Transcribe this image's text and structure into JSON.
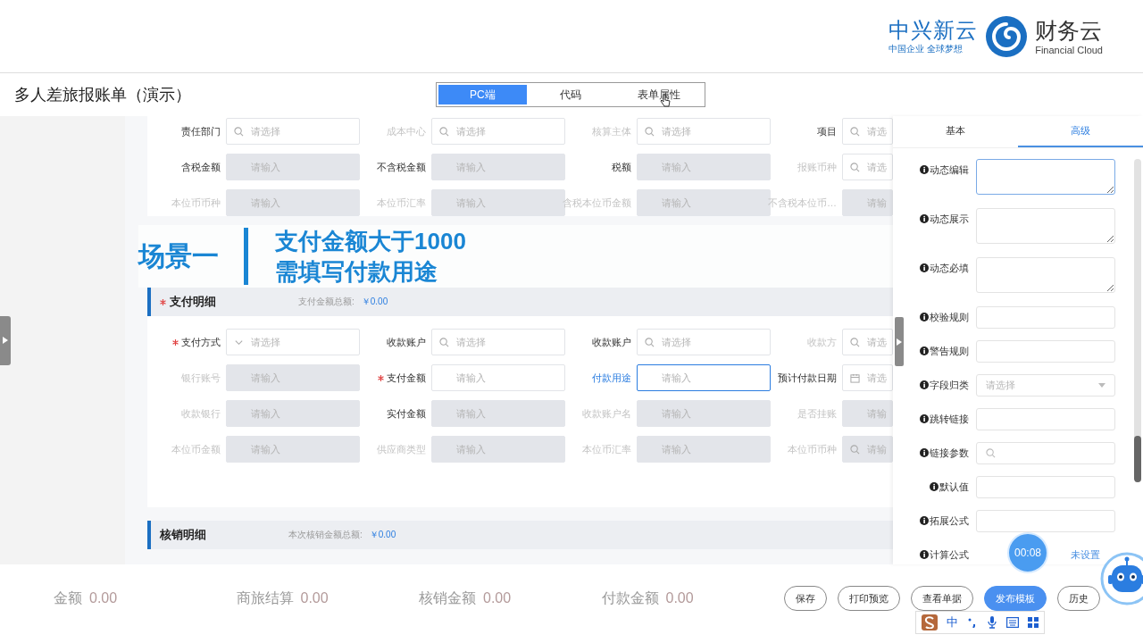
{
  "header": {
    "brand": "中兴新云",
    "slogan": "中国企业 全球梦想",
    "product": "财务云",
    "product_en": "Financial Cloud"
  },
  "title": "多人差旅报账单（演示）",
  "view_tabs": [
    {
      "label": "PC端",
      "selected": true
    },
    {
      "label": "代码",
      "selected": false
    },
    {
      "label": "表单属性",
      "selected": false
    }
  ],
  "form_top": {
    "rows": [
      [
        {
          "label": "责任部门",
          "kind": "select",
          "placeholder": "请选择",
          "muted": false,
          "readonly": false,
          "required": false,
          "focused": false
        },
        {
          "label": "成本中心",
          "kind": "select",
          "placeholder": "请选择",
          "muted": true,
          "readonly": false,
          "required": false,
          "focused": false
        },
        {
          "label": "核算主体",
          "kind": "select",
          "placeholder": "请选择",
          "muted": true,
          "readonly": false,
          "required": false,
          "focused": false
        },
        {
          "label": "项目",
          "kind": "select",
          "placeholder": "请选",
          "muted": false,
          "readonly": false,
          "required": false,
          "focused": false
        }
      ],
      [
        {
          "label": "含税金额",
          "kind": "text",
          "placeholder": "请输入",
          "muted": false,
          "readonly": true,
          "required": false,
          "focused": false
        },
        {
          "label": "不含税金额",
          "kind": "text",
          "placeholder": "请输入",
          "muted": false,
          "readonly": true,
          "required": false,
          "focused": false
        },
        {
          "label": "税额",
          "kind": "text",
          "placeholder": "请输入",
          "muted": false,
          "readonly": true,
          "required": false,
          "focused": false
        },
        {
          "label": "报账币种",
          "kind": "select",
          "placeholder": "请选",
          "muted": true,
          "readonly": false,
          "required": false,
          "focused": false
        }
      ],
      [
        {
          "label": "本位币币种",
          "kind": "text",
          "placeholder": "请输入",
          "muted": true,
          "readonly": true,
          "required": false,
          "focused": false
        },
        {
          "label": "本位币汇率",
          "kind": "text",
          "placeholder": "请输入",
          "muted": true,
          "readonly": true,
          "required": false,
          "focused": false
        },
        {
          "label": "含税本位币金额",
          "kind": "text",
          "placeholder": "请输入",
          "muted": true,
          "readonly": true,
          "required": false,
          "focused": false
        },
        {
          "label": "不含税本位币…",
          "kind": "text",
          "placeholder": "请输",
          "muted": true,
          "readonly": true,
          "required": false,
          "focused": false
        }
      ]
    ]
  },
  "callout": {
    "tag": "场景一",
    "lines": [
      "支付金额大于1000",
      "需填写付款用途"
    ]
  },
  "payment": {
    "title": "支付明细",
    "required": true,
    "total_label": "支付金额总额:",
    "total": "￥0.00",
    "rows": [
      [
        {
          "label": "支付方式",
          "kind": "dropdown",
          "placeholder": "请选择",
          "muted": false,
          "readonly": false,
          "required": true,
          "focused": false
        },
        {
          "label": "收款账户",
          "kind": "select",
          "placeholder": "请选择",
          "muted": false,
          "readonly": false,
          "required": false,
          "focused": false
        },
        {
          "label": "收款账户",
          "kind": "select",
          "placeholder": "请选择",
          "muted": false,
          "readonly": false,
          "required": false,
          "focused": false
        },
        {
          "label": "收款方",
          "kind": "select",
          "placeholder": "请选",
          "muted": true,
          "readonly": false,
          "required": false,
          "focused": false
        }
      ],
      [
        {
          "label": "银行账号",
          "kind": "text",
          "placeholder": "请输入",
          "muted": true,
          "readonly": true,
          "required": false,
          "focused": false
        },
        {
          "label": "支付金额",
          "kind": "text",
          "placeholder": "请输入",
          "muted": false,
          "readonly": false,
          "required": true,
          "focused": false
        },
        {
          "label": "付款用途",
          "kind": "text",
          "placeholder": "请输入",
          "muted": false,
          "readonly": false,
          "required": false,
          "focused": true
        },
        {
          "label": "预计付款日期",
          "kind": "date",
          "placeholder": "请选",
          "muted": false,
          "readonly": false,
          "required": false,
          "focused": false
        }
      ],
      [
        {
          "label": "收款银行",
          "kind": "text",
          "placeholder": "请输入",
          "muted": true,
          "readonly": true,
          "required": false,
          "focused": false
        },
        {
          "label": "实付金额",
          "kind": "text",
          "placeholder": "请输入",
          "muted": false,
          "readonly": true,
          "required": false,
          "focused": false
        },
        {
          "label": "收款账户名",
          "kind": "text",
          "placeholder": "请输入",
          "muted": true,
          "readonly": true,
          "required": false,
          "focused": false
        },
        {
          "label": "是否挂账",
          "kind": "text",
          "placeholder": "请输",
          "muted": true,
          "readonly": true,
          "required": false,
          "focused": false
        }
      ],
      [
        {
          "label": "本位币金额",
          "kind": "text",
          "placeholder": "请输入",
          "muted": true,
          "readonly": true,
          "required": false,
          "focused": false
        },
        {
          "label": "供应商类型",
          "kind": "text",
          "placeholder": "请输入",
          "muted": true,
          "readonly": true,
          "required": false,
          "focused": false
        },
        {
          "label": "本位币汇率",
          "kind": "text",
          "placeholder": "请输入",
          "muted": true,
          "readonly": true,
          "required": false,
          "focused": false
        },
        {
          "label": "本位币币种",
          "kind": "select",
          "placeholder": "请输",
          "muted": true,
          "readonly": true,
          "required": false,
          "focused": false
        }
      ]
    ]
  },
  "writeoff": {
    "title": "核销明细",
    "required": false,
    "total_label": "本次核销金额总额:",
    "total": "￥0.00"
  },
  "panel": {
    "tabs": [
      {
        "label": "基本",
        "selected": false
      },
      {
        "label": "高级",
        "selected": true
      }
    ],
    "props": [
      {
        "label": "动态编辑",
        "kind": "textarea",
        "focused": true
      },
      {
        "label": "动态展示",
        "kind": "textarea",
        "focused": false
      },
      {
        "label": "动态必填",
        "kind": "textarea",
        "focused": false
      },
      {
        "label": "校验规则",
        "kind": "input",
        "focused": false
      },
      {
        "label": "警告规则",
        "kind": "input",
        "focused": false
      },
      {
        "label": "字段归类",
        "kind": "select",
        "placeholder": "请选择",
        "focused": false
      },
      {
        "label": "跳转链接",
        "kind": "input",
        "focused": false
      },
      {
        "label": "链接参数",
        "kind": "search",
        "focused": false
      },
      {
        "label": "默认值",
        "kind": "input",
        "focused": false
      },
      {
        "label": "拓展公式",
        "kind": "input",
        "focused": false
      },
      {
        "label": "计算公式",
        "kind": "link",
        "value": "未设置",
        "focused": false
      }
    ]
  },
  "totals": [
    {
      "label": "金额",
      "value": "0.00"
    },
    {
      "label": "商旅结算",
      "value": "0.00"
    },
    {
      "label": "核销金额",
      "value": "0.00"
    },
    {
      "label": "付款金额",
      "value": "0.00"
    }
  ],
  "buttons": [
    {
      "label": "保存",
      "kind": "outline"
    },
    {
      "label": "打印预览",
      "kind": "outline"
    },
    {
      "label": "查看单据",
      "kind": "outline"
    },
    {
      "label": "发布模板",
      "kind": "primary"
    },
    {
      "label": "历史",
      "kind": "outline"
    }
  ],
  "timer": "00:08",
  "ime": {
    "mode": "中"
  }
}
